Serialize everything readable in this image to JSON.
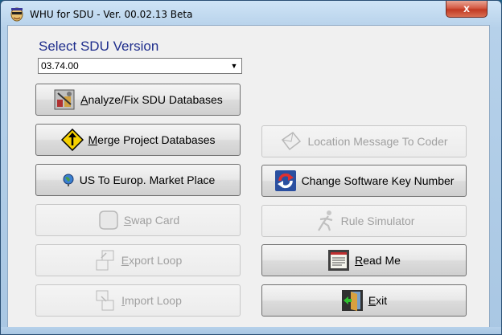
{
  "window": {
    "title": "WHU for SDU - Ver. 00.02.13 Beta",
    "close_label": "x"
  },
  "heading": "Select SDU Version",
  "version_select": {
    "value": "03.74.00",
    "arrow": "▼"
  },
  "buttons": {
    "analyze": {
      "mnemonic": "A",
      "rest": "nalyze/Fix SDU Databases",
      "icon": "database-tools-icon"
    },
    "merge": {
      "mnemonic": "M",
      "rest": "erge Project Databases",
      "icon": "merge-sign-icon"
    },
    "location": {
      "label": "Location Message To Coder",
      "icon": "envelope-icon"
    },
    "us_europe": {
      "label": "US To Europ. Market Place",
      "icon": "globe-icon"
    },
    "change_key": {
      "label": "Change Software Key Number",
      "icon": "refresh-arrows-icon"
    },
    "swap": {
      "mnemonic": "S",
      "rest": "wap Card",
      "icon": "card-icon"
    },
    "rule_sim": {
      "label": "Rule Simulator",
      "icon": "runner-icon"
    },
    "export": {
      "mnemonic": "E",
      "rest": "xport Loop",
      "icon": "export-pages-icon"
    },
    "read_me": {
      "mnemonic": "R",
      "rest": "ead Me",
      "icon": "document-icon"
    },
    "import": {
      "mnemonic": "I",
      "rest": "mport Loop",
      "icon": "import-pages-icon"
    },
    "exit": {
      "mnemonic": "E",
      "rest": "xit",
      "icon": "exit-door-icon"
    }
  },
  "colors": {
    "heading": "#1e2d8c",
    "disabled_text": "#a0a0a0",
    "close_button": "#c13a23"
  }
}
